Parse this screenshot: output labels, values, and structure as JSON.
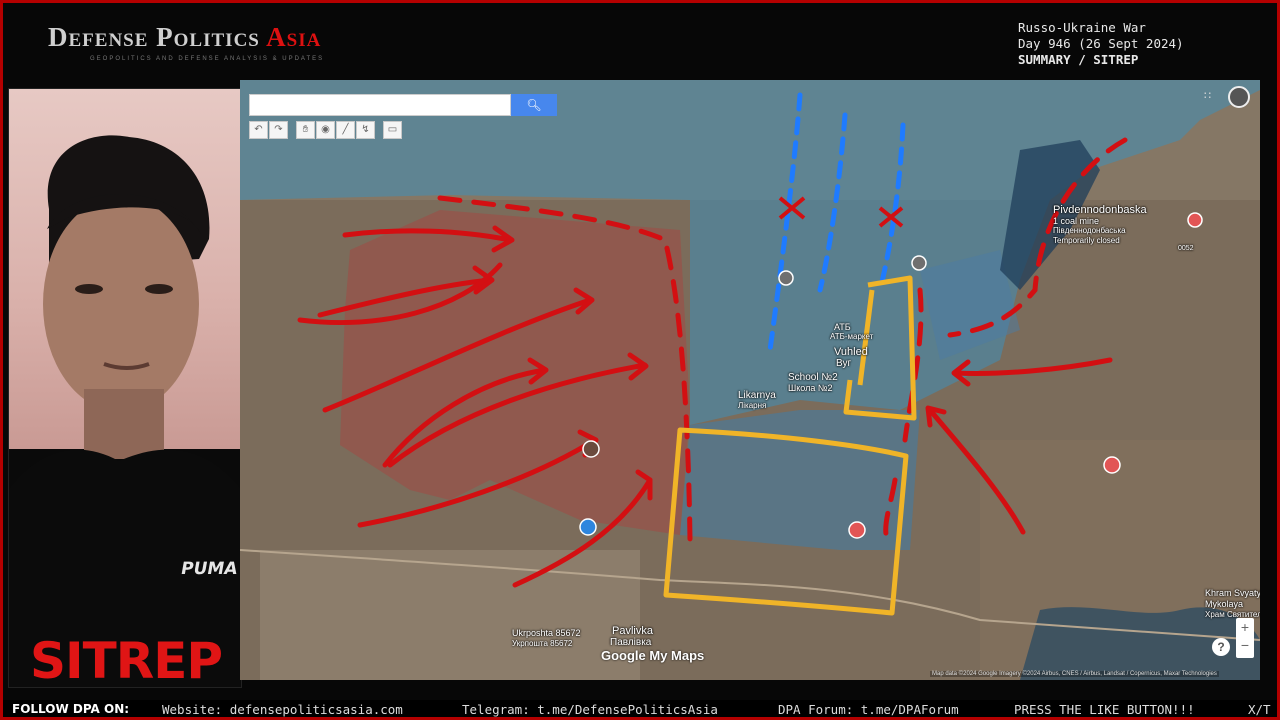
{
  "header": {
    "brand_main": "Defense Politics ",
    "brand_accent": "Asia",
    "brand_sub": "GEOPOLITICS AND DEFENSE ANALYSIS & UPDATES",
    "war_title": "Russo-Ukraine War",
    "war_day": "Day 946 (26 Sept 2024)",
    "war_type": "SUMMARY / SITREP"
  },
  "webcam": {
    "shirt_logo": "PUMA",
    "overlay_label": "SITREP"
  },
  "map": {
    "search": {
      "placeholder": "",
      "button_icon": "search-icon"
    },
    "toolbar_icons": [
      "undo-icon",
      "redo-icon",
      "pan-hand-icon",
      "marker-icon",
      "draw-line-icon",
      "route-icon",
      "measure-icon"
    ],
    "labels": {
      "pivdennodonbaska": "Pivdennodonbaska",
      "coal_mine": "1 coal mine",
      "coal_mine_local": "Пiвденнодонбаська",
      "temp_closed": "Temporarily closed",
      "atb": "АТБ",
      "atb_local": "АТБ-маркет",
      "vuhledar": "Vuhled",
      "vuhledar_local": "Вуг",
      "school": "School №2",
      "school_local": "Школа №2",
      "likarnya": "Likarnya",
      "likarnya_local": "Лікарня",
      "pavlivka": "Pavlivka",
      "pavlivka_local": "Павлівка",
      "ukrposhta": "Ukrposhta 85672",
      "ukrposhta_local": "Укрпошта 85672",
      "khram": "Khram Svyatytelya",
      "khram2": "Mykolaya",
      "khram_local": "Храм Святителя",
      "road": "0052"
    },
    "google_logo": "Google My Maps",
    "attribution": "Map data ©2024 Google Imagery ©2024 Airbus, CNES / Airbus, Landsat / Copernicus, Maxar Technologies",
    "help": "?",
    "colors": {
      "russian_zone": "#b33a3a",
      "ukrainian_zone": "#3f8fb8",
      "arrows": "#d30f12",
      "highlight": "#f0b428",
      "ukr_lines": "#1f7bff"
    }
  },
  "ticker": {
    "follow": "FOLLOW DPA ON:",
    "website": "Website: defensepoliticsasia.com",
    "telegram": "Telegram: t.me/DefensePoliticsAsia",
    "forum": "DPA Forum: t.me/DPAForum",
    "like": "PRESS THE LIKE BUTTON!!!",
    "x": "X/T"
  }
}
